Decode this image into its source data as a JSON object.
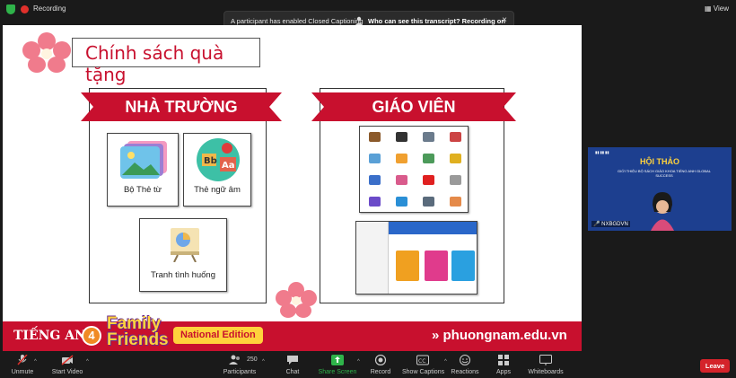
{
  "topbar": {
    "recording_label": "Recording",
    "view_label": "View",
    "view_icon": "view-grid-icon"
  },
  "caption_banner": {
    "message": "A participant has enabled Closed Captioning",
    "link": "Who can see this transcript? Recording on",
    "close": "×"
  },
  "slide": {
    "title": "Chính sách quà tặng",
    "left_panel": {
      "heading": "NHÀ TRƯỜNG",
      "cards": [
        {
          "label": "Bộ Thẻ từ"
        },
        {
          "label": "Thẻ ngữ âm"
        },
        {
          "label": "Tranh tình huống"
        }
      ]
    },
    "right_panel": {
      "heading": "GIÁO VIÊN"
    },
    "footer": {
      "subject": "TIẾNG ANH",
      "grade": "4",
      "brand_line1": "Family",
      "brand_line2": "Friends",
      "edition": "National Edition",
      "url": "phuongnam.edu.vn"
    }
  },
  "video": {
    "title": "HỘI THẢO",
    "subtitle": "GIỚI THIỆU BỘ SÁCH GIÁO KHOA TIẾNG ANH GLOBAL SUCCESS",
    "participant_name": "NXBGDVN"
  },
  "toolbar": {
    "unmute": "Unmute",
    "start_video": "Start Video",
    "participants": "Participants",
    "participants_count": "250",
    "chat": "Chat",
    "share_screen": "Share Screen",
    "record": "Record",
    "show_captions": "Show Captions",
    "reactions": "Reactions",
    "apps": "Apps",
    "whiteboards": "Whiteboards",
    "leave": "Leave"
  },
  "colors": {
    "brand_red": "#c8102e",
    "share_green": "#2fb34a",
    "leave_red": "#d4232a",
    "highlight_yellow": "#ffd23c"
  }
}
